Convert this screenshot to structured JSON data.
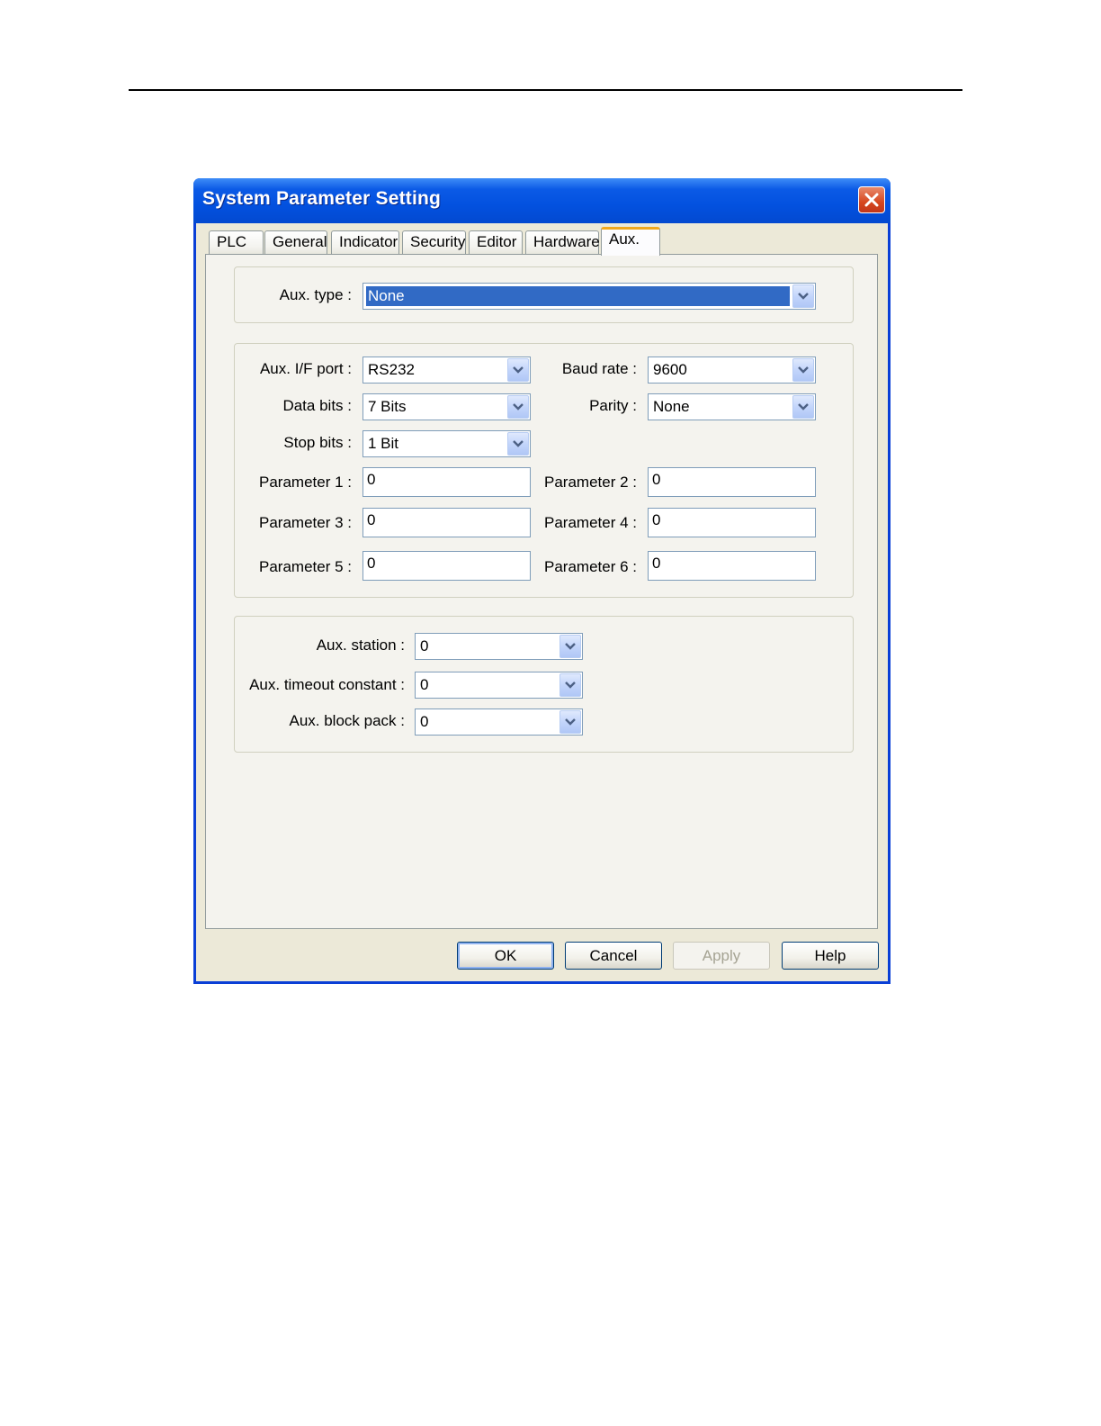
{
  "window": {
    "title": "System Parameter Setting"
  },
  "tabs": [
    {
      "label": "PLC"
    },
    {
      "label": "General"
    },
    {
      "label": "Indicator"
    },
    {
      "label": "Security"
    },
    {
      "label": "Editor"
    },
    {
      "label": "Hardware"
    },
    {
      "label": "Aux."
    }
  ],
  "active_tab": "Aux.",
  "aux_type": {
    "label": "Aux. type :",
    "value": "None"
  },
  "comm": {
    "aux_if_port": {
      "label": "Aux. I/F port :",
      "value": "RS232"
    },
    "baud_rate": {
      "label": "Baud rate :",
      "value": "9600"
    },
    "data_bits": {
      "label": "Data bits :",
      "value": "7 Bits"
    },
    "parity": {
      "label": "Parity :",
      "value": "None"
    },
    "stop_bits": {
      "label": "Stop bits :",
      "value": "1 Bit"
    },
    "param1": {
      "label": "Parameter 1 :",
      "value": "0"
    },
    "param2": {
      "label": "Parameter 2 :",
      "value": "0"
    },
    "param3": {
      "label": "Parameter 3 :",
      "value": "0"
    },
    "param4": {
      "label": "Parameter 4 :",
      "value": "0"
    },
    "param5": {
      "label": "Parameter 5 :",
      "value": "0"
    },
    "param6": {
      "label": "Parameter 6 :",
      "value": "0"
    }
  },
  "station": {
    "aux_station": {
      "label": "Aux. station :",
      "value": "0"
    },
    "aux_timeout": {
      "label": "Aux. timeout constant :",
      "value": "0"
    },
    "aux_block_pack": {
      "label": "Aux. block pack :",
      "value": "0"
    }
  },
  "buttons": {
    "ok": "OK",
    "cancel": "Cancel",
    "apply": "Apply",
    "help": "Help"
  },
  "colors": {
    "titlebar": "#0351df",
    "selection": "#316ac5",
    "active_tab_accent": "#f1a81d",
    "close_button": "#d6471f"
  }
}
